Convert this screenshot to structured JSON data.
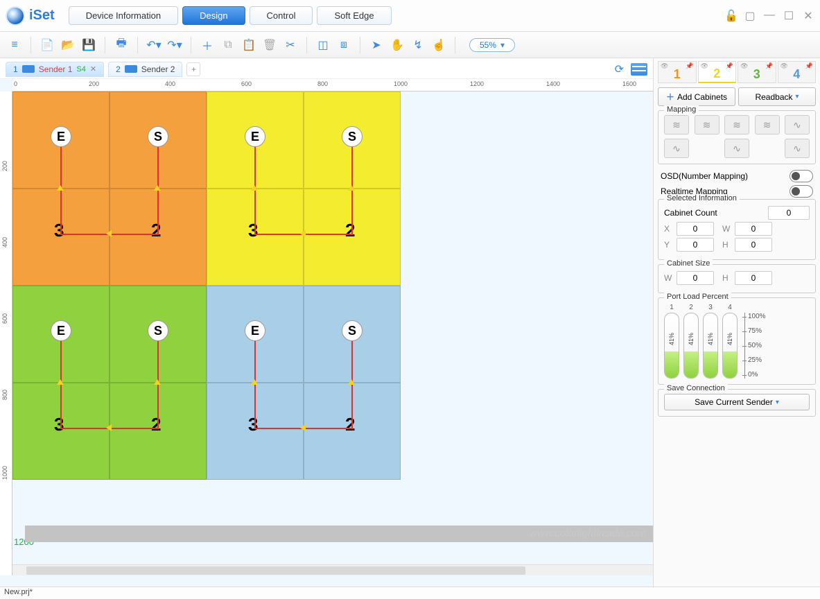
{
  "app_name": "iSet",
  "main_tabs": {
    "device": "Device Information",
    "design": "Design",
    "control": "Control",
    "softedge": "Soft Edge"
  },
  "zoom": "55%",
  "senders": [
    {
      "num": "1",
      "name": "Sender 1",
      "signal": "S4",
      "active": true
    },
    {
      "num": "2",
      "name": "Sender 2",
      "signal": "",
      "active": false
    }
  ],
  "ruler_h": [
    "0",
    "200",
    "400",
    "600",
    "800",
    "1000",
    "1200",
    "1400",
    "1600"
  ],
  "ruler_v": [
    "200",
    "400",
    "600",
    "800",
    "1000"
  ],
  "boundary": "1200",
  "cabinets": {
    "labels": {
      "E": "E",
      "S": "S",
      "n3": "3",
      "n2": "2"
    }
  },
  "watermark": "www.colorlightinside.com",
  "right": {
    "ports": [
      "1",
      "2",
      "3",
      "4"
    ],
    "add_cabinets": "Add Cabinets",
    "readback": "Readback",
    "mapping": "Mapping",
    "osd": "OSD(Number Mapping)",
    "realtime": "Realtime Mapping",
    "selected_info": "Selected Information",
    "cabinet_count_label": "Cabinet Count",
    "cabinet_count": "0",
    "x_label": "X",
    "y_label": "Y",
    "w_label": "W",
    "h_label": "H",
    "x": "0",
    "y": "0",
    "w": "0",
    "h": "0",
    "cabinet_size": "Cabinet Size",
    "cs_w": "0",
    "cs_h": "0",
    "port_load": "Port Load Percent",
    "load_pct": "41%",
    "scale": [
      "100%",
      "75%",
      "50%",
      "25%",
      "0%"
    ],
    "save_conn": "Save Connection",
    "save_sender": "Save Current Sender"
  },
  "status": "New.prj*"
}
